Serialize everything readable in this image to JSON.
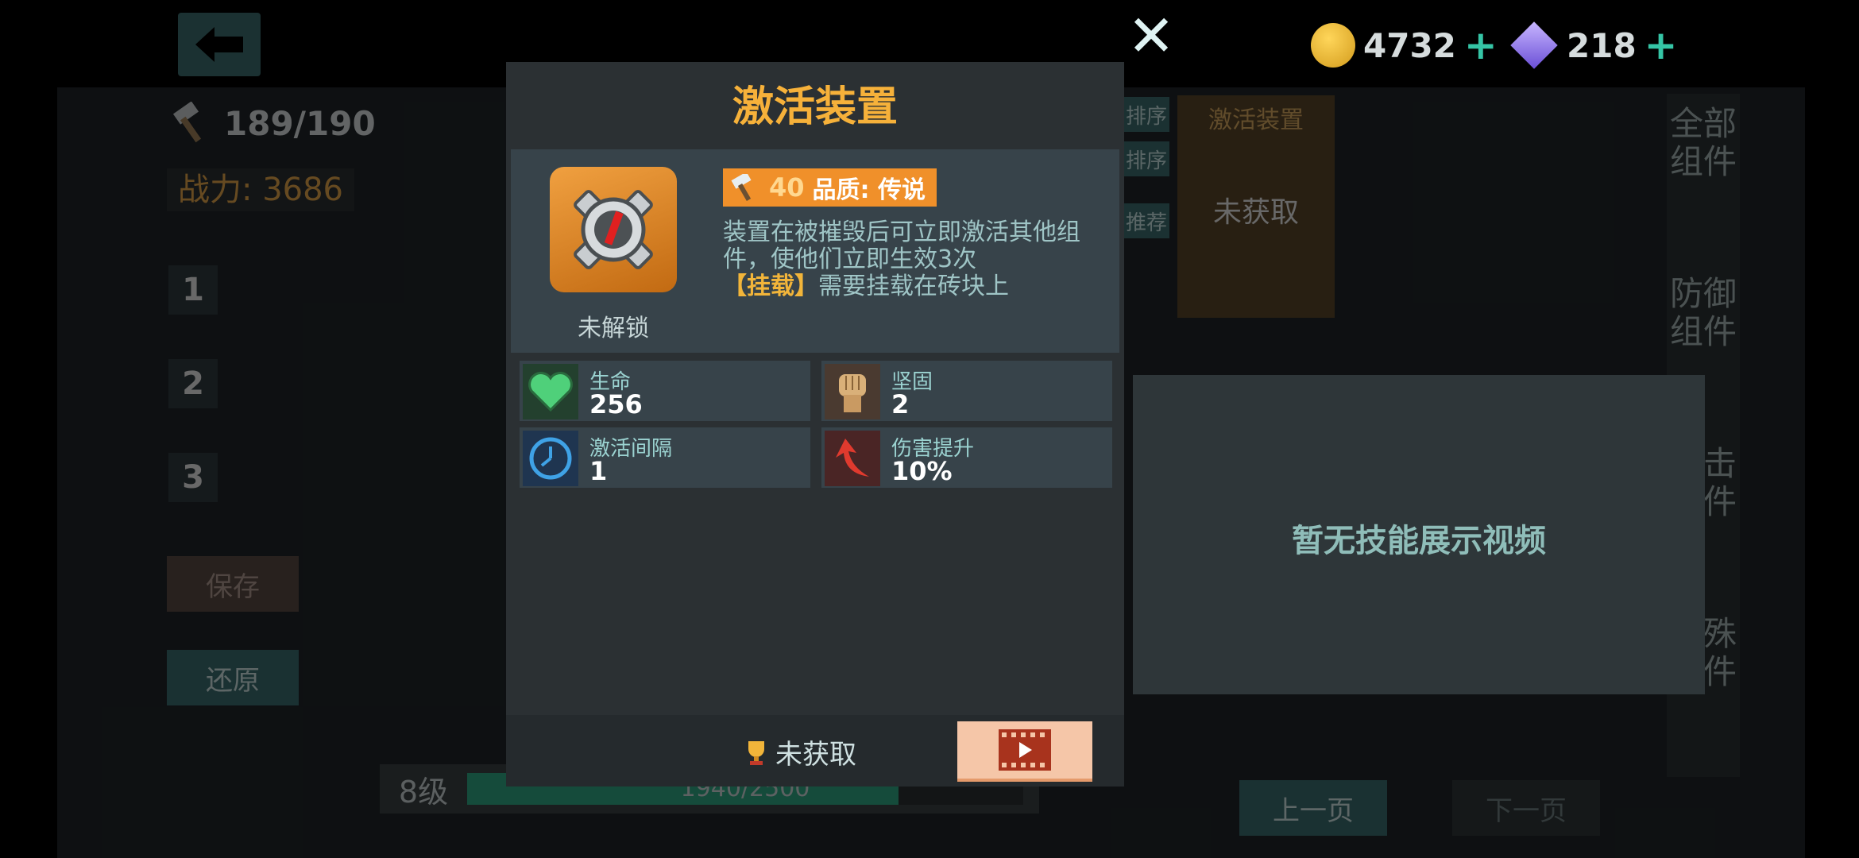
{
  "background": {
    "hammer_count": "189/190",
    "power_label": "战力: 3686",
    "slots": [
      "1",
      "2",
      "3"
    ],
    "save_label": "保存",
    "restore_label": "还原",
    "level_label": "8级",
    "level_progress_text": "1940/2500",
    "level_progress": 0.776,
    "sort_labels": [
      "排序",
      "排序",
      "推荐"
    ],
    "card_title": "激活装置",
    "card_state": "未获取",
    "prev_page": "上一页",
    "next_page": "下一页",
    "right_tabs": [
      "全部组件",
      "防御组件",
      "攻击组件",
      "特殊组件"
    ]
  },
  "currency": {
    "coins": "4732",
    "gems": "218"
  },
  "modal": {
    "title": "激活装置",
    "lock_status": "未解锁",
    "quality_level": "40",
    "quality_label": "品质: 传说",
    "description": "装置在被摧毁后可立即激活其他组件，使他们立即生效3次",
    "mount_tag": "【挂载】",
    "mount_text": "需要挂载在砖块上",
    "stats": [
      {
        "name": "生命",
        "value": "256",
        "icon": "heart-icon"
      },
      {
        "name": "坚固",
        "value": "2",
        "icon": "fist-icon"
      },
      {
        "name": "激活间隔",
        "value": "1",
        "icon": "clock-icon"
      },
      {
        "name": "伤害提升",
        "value": "10%",
        "icon": "arrow-up-icon"
      }
    ],
    "reward_status": "未获取"
  },
  "video_panel": {
    "empty_text": "暂无技能展示视频"
  },
  "colors": {
    "accent": "#f6b13a",
    "panel": "#2b3033",
    "teal": "#3b6e6f"
  }
}
